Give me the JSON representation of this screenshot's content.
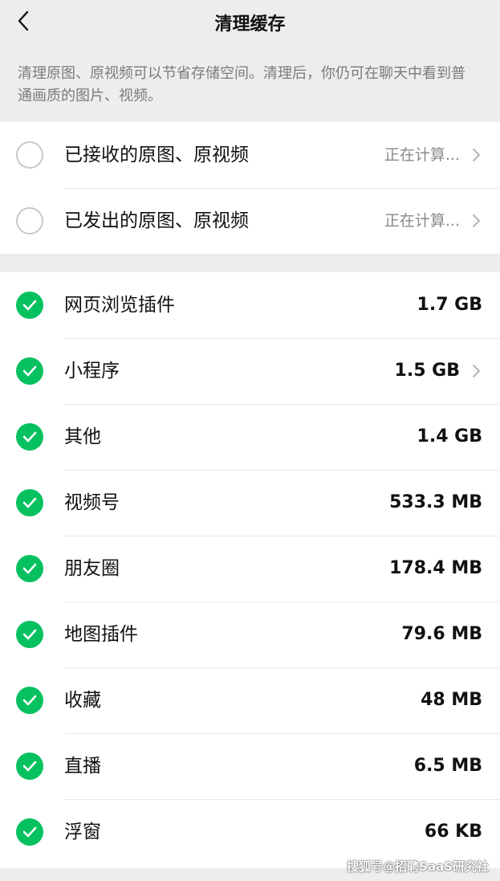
{
  "nav": {
    "title": "清理缓存"
  },
  "description": "清理原图、原视频可以节省存储空间。清理后，你仍可在聊天中看到普通画质的图片、视频。",
  "originals": [
    {
      "label": "已接收的原图、原视频",
      "status": "正在计算..."
    },
    {
      "label": "已发出的原图、原视频",
      "status": "正在计算..."
    }
  ],
  "cache_items": [
    {
      "label": "网页浏览插件",
      "size": "1.7 GB"
    },
    {
      "label": "小程序",
      "size": "1.5 GB"
    },
    {
      "label": "其他",
      "size": "1.4 GB"
    },
    {
      "label": "视频号",
      "size": "533.3 MB"
    },
    {
      "label": "朋友圈",
      "size": "178.4 MB"
    },
    {
      "label": "地图插件",
      "size": "79.6 MB"
    },
    {
      "label": "收藏",
      "size": "48 MB"
    },
    {
      "label": "直播",
      "size": "6.5 MB"
    },
    {
      "label": "浮窗",
      "size": "66 KB"
    }
  ],
  "watermark": "搜狐号@招聘SaaS研究社",
  "colors": {
    "accent": "#07c160",
    "background": "#ededed"
  }
}
